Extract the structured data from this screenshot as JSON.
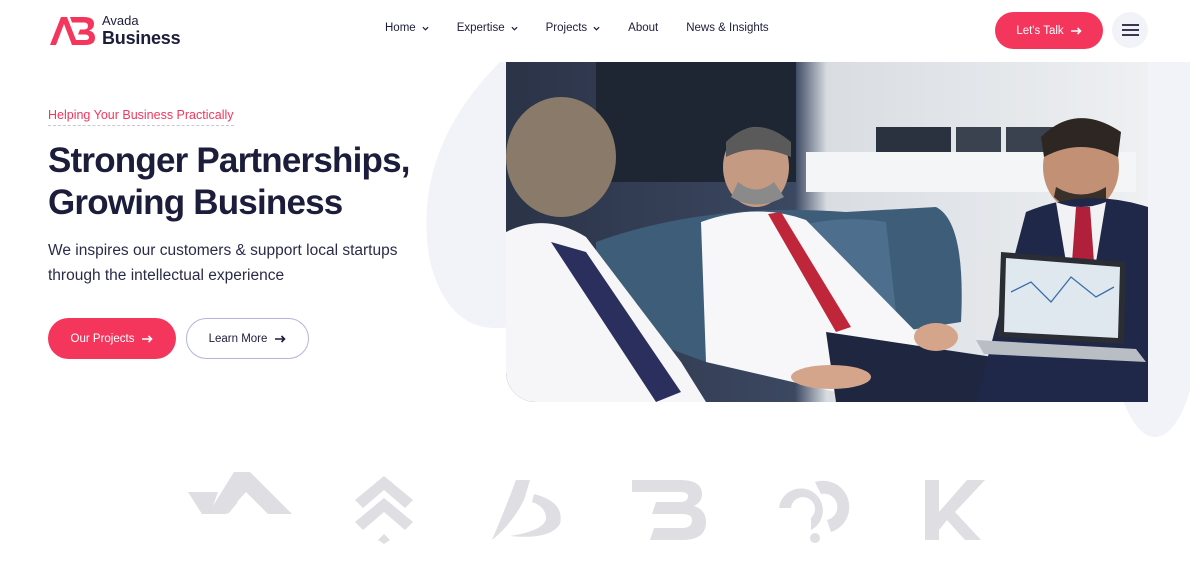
{
  "brand": {
    "name_top": "Avada",
    "name_bottom": "Business",
    "color": "#f5365c"
  },
  "nav": {
    "items": [
      {
        "label": "Home",
        "dropdown": true
      },
      {
        "label": "Expertise",
        "dropdown": true
      },
      {
        "label": "Projects",
        "dropdown": true
      },
      {
        "label": "About",
        "dropdown": false
      },
      {
        "label": "News & Insights",
        "dropdown": false
      }
    ],
    "cta_label": "Let's Talk",
    "menu_icon": "hamburger-icon"
  },
  "hero": {
    "tagline": "Helping Your Business Practically",
    "headline_line1": "Stronger Partnerships,",
    "headline_line2": "Growing Business",
    "subtext_line1": "We inspires our customers & support local startups",
    "subtext_line2": "through the intellectual experience",
    "primary_button": "Our Projects",
    "secondary_button": "Learn More",
    "photo_icon": "business-meeting-photo"
  },
  "partners": {
    "icons": [
      "partner-logo-a-icon",
      "partner-logo-chevrons-icon",
      "partner-logo-swoosh-icon",
      "partner-logo-b-icon",
      "partner-logo-circles-icon",
      "partner-logo-k-icon"
    ]
  },
  "colors": {
    "accent": "#f5365c",
    "text": "#1c1d3a",
    "blob": "#f2f3f8",
    "logo_gray": "#dedee3"
  }
}
